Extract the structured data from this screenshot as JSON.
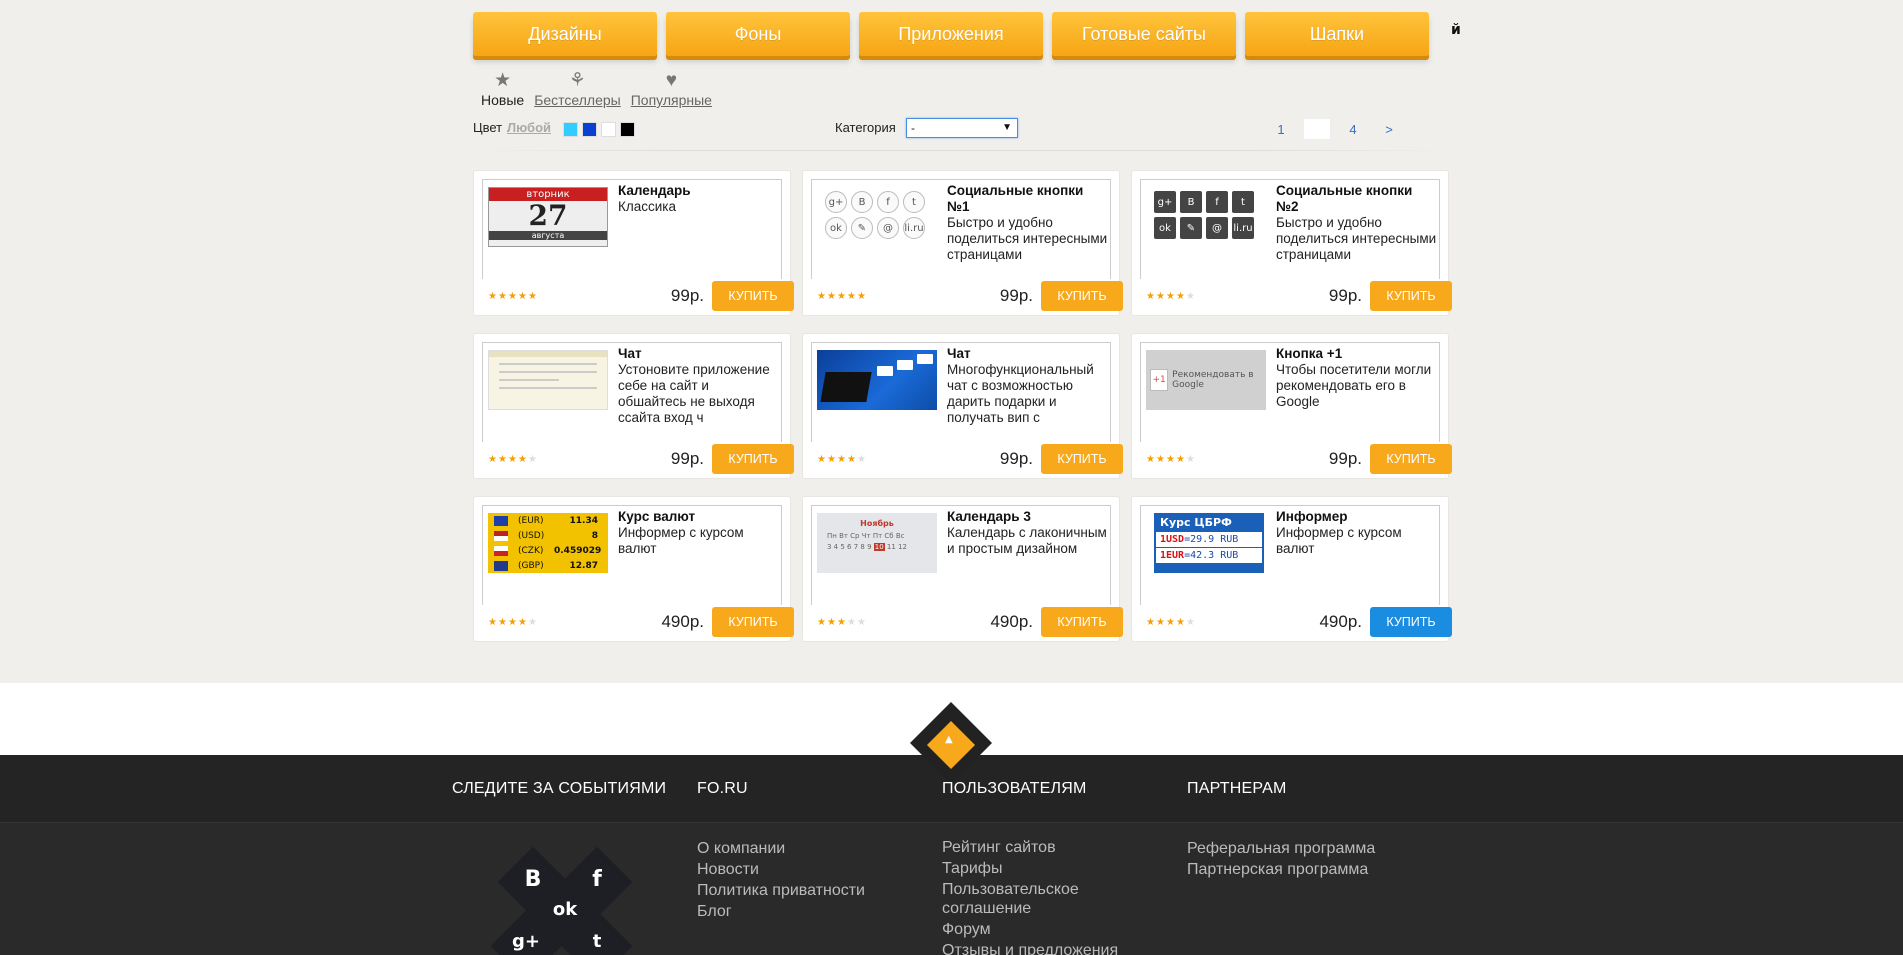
{
  "tabs": [
    "Дизайны",
    "Фоны",
    "Приложения",
    "Готовые сайты",
    "Шапки"
  ],
  "tab_overflow": "й",
  "sorts": [
    {
      "label": "Новые",
      "icon": "star-icon",
      "active": true
    },
    {
      "label": "Бестселлеры",
      "icon": "award-icon",
      "active": false
    },
    {
      "label": "Популярные",
      "icon": "heart-icon",
      "active": false
    }
  ],
  "filters": {
    "color_label": "Цвет",
    "color_any": "Любой",
    "swatches": [
      "#33ccff",
      "#0a3fd1",
      "#ffffff",
      "#000000"
    ],
    "category_label": "Категория",
    "category_value": "-"
  },
  "pager": {
    "pages": [
      "1",
      "",
      "4",
      ">"
    ],
    "current_index": 1
  },
  "products": [
    {
      "title": "Календарь",
      "desc": "Классика",
      "rating": 5,
      "price": "99р.",
      "buy": "КУПИТЬ",
      "thumb": "calendar"
    },
    {
      "title": "Социальные кнопки №1",
      "desc": "Быстро и удобно поделиться интересными страницами",
      "rating": 5,
      "price": "99р.",
      "buy": "КУПИТЬ",
      "thumb": "social-round"
    },
    {
      "title": "Социальные кнопки №2",
      "desc": "Быстро и удобно поделиться интересными страницами",
      "rating": 4,
      "price": "99р.",
      "buy": "КУПИТЬ",
      "thumb": "social-square"
    },
    {
      "title": "Чат",
      "desc": "Устоновите приложение себе на сайт и обшайтесь не выходя ссайта вход ч",
      "rating": 4,
      "price": "99р.",
      "buy": "КУПИТЬ",
      "thumb": "chat"
    },
    {
      "title": "Чат",
      "desc": "Многофункциональный чат с возможностью дарить подарки и получать вип с",
      "rating": 4,
      "price": "99р.",
      "buy": "КУПИТЬ",
      "thumb": "laptop"
    },
    {
      "title": "Кнопка +1",
      "desc": "Чтобы посетители могли рекомендовать его в Google",
      "rating": 4,
      "price": "99р.",
      "buy": "КУПИТЬ",
      "thumb": "plusone"
    },
    {
      "title": "Курс валют",
      "desc": "Информер с курсом валют",
      "rating": 4,
      "price": "490р.",
      "buy": "КУПИТЬ",
      "thumb": "currency"
    },
    {
      "title": "Календарь 3",
      "desc": "Календарь с лаконичным и простым дизайном",
      "rating": 3,
      "price": "490р.",
      "buy": "КУПИТЬ",
      "thumb": "november"
    },
    {
      "title": "Информер",
      "desc": "Информер с курсом валют",
      "rating": 4,
      "price": "490р.",
      "buy": "КУПИТЬ",
      "thumb": "cbr",
      "hover": true
    }
  ],
  "thumbs": {
    "calendar": {
      "day": "вторник",
      "num": "27",
      "month": "августа"
    },
    "social_round": [
      "g+",
      "B",
      "f",
      "t",
      "ok",
      "✎",
      "@",
      "li.ru"
    ],
    "social_square": [
      "g+",
      "B",
      "f",
      "t",
      "ok",
      "✎",
      "@",
      "li.ru"
    ],
    "plusone": {
      "btn": "+1",
      "text": "Рекомендовать в Google"
    },
    "currency": [
      {
        "code": "(EUR)",
        "val": "11.34"
      },
      {
        "code": "(USD)",
        "val": "8"
      },
      {
        "code": "(CZK)",
        "val": "0.459029"
      },
      {
        "code": "(GBP)",
        "val": "12.87"
      }
    ],
    "november": {
      "month": "Ноябрь",
      "days": "Пн Вт Ср Чт Пт Сб Вс",
      "hl": "10"
    },
    "cbr": {
      "head": "Курс ЦБРФ",
      "usd_k": "1USD",
      "usd_v": "=29.9 RUB",
      "eur_k": "1EUR",
      "eur_v": "=42.3 RUB"
    }
  },
  "footer": {
    "follow": "СЛЕДИТЕ ЗА СОБЫТИЯМИ",
    "col_fo": {
      "head": "FO.RU",
      "links": [
        "О компании",
        "Новости",
        "Политика приватности",
        "Блог"
      ]
    },
    "col_users": {
      "head": "ПОЛЬЗОВАТЕЛЯМ",
      "links": [
        "Рейтинг сайтов",
        "Тарифы",
        "Пользовательское соглашение",
        "Форум",
        "Отзывы и предложения"
      ]
    },
    "col_partners": {
      "head": "ПАРТНЕРАМ",
      "links": [
        "Реферальная программа",
        "Партнерская программа"
      ]
    },
    "social": [
      "B",
      "f",
      "ok",
      "g+",
      "t"
    ]
  },
  "colors": {
    "accent": "#f7a81b",
    "hover_blue": "#1a8de0",
    "footer_bg": "#2a2a2a"
  }
}
